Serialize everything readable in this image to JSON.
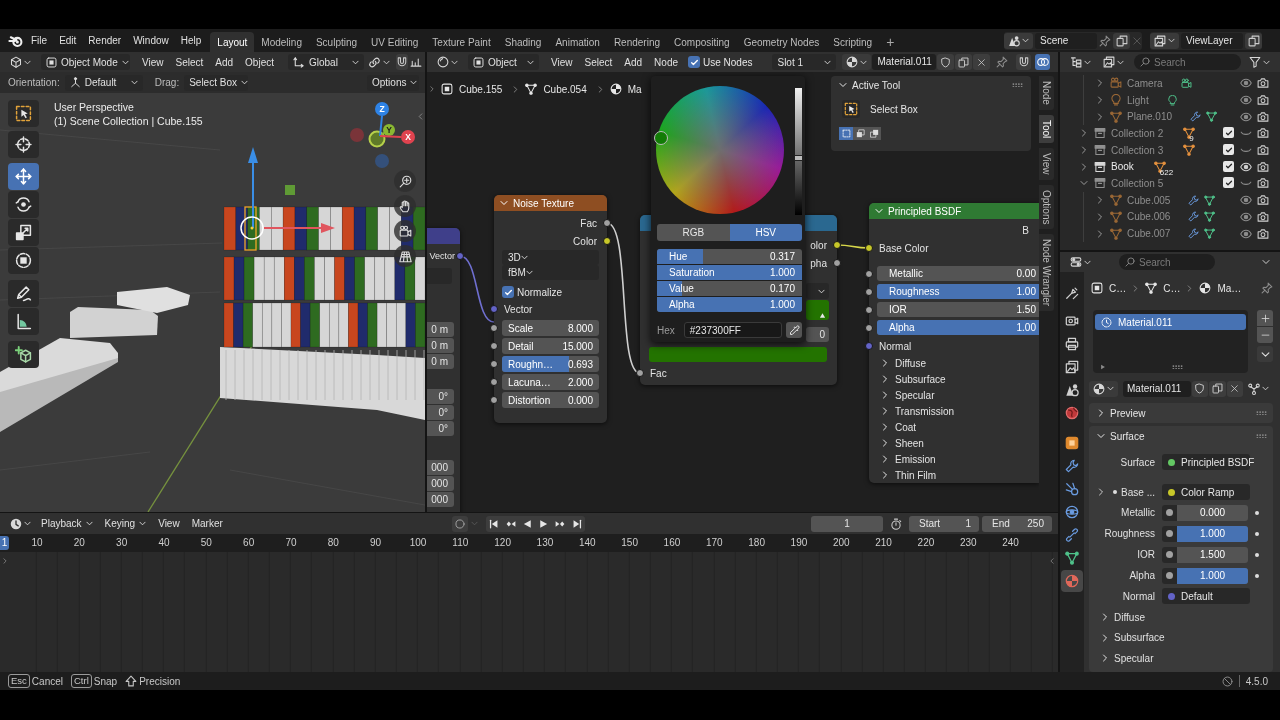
{
  "top_bar": {
    "menus": [
      "File",
      "Edit",
      "Render",
      "Window",
      "Help"
    ],
    "workspaces": [
      {
        "label": "Layout",
        "selected": true
      },
      {
        "label": "Modeling",
        "selected": false
      },
      {
        "label": "Sculpting",
        "selected": false
      },
      {
        "label": "UV Editing",
        "selected": false
      },
      {
        "label": "Texture Paint",
        "selected": false
      },
      {
        "label": "Shading",
        "selected": false
      },
      {
        "label": "Animation",
        "selected": false
      },
      {
        "label": "Rendering",
        "selected": false
      },
      {
        "label": "Compositing",
        "selected": false
      },
      {
        "label": "Geometry Nodes",
        "selected": false
      },
      {
        "label": "Scripting",
        "selected": false
      }
    ],
    "add_workspace": "+",
    "scene": "Scene",
    "view_layer": "ViewLayer"
  },
  "viewport": {
    "header": {
      "mode": "Object Mode",
      "menus": [
        "View",
        "Select",
        "Add",
        "Object"
      ],
      "orientation": "Global"
    },
    "tool_settings": {
      "orientation_label": "Orientation:",
      "orientation": "Default",
      "drag_label": "Drag:",
      "drag": "Select Box",
      "options": "Options"
    },
    "tools": [
      {
        "selected": false
      },
      {
        "selected": false
      },
      {
        "selected": true
      },
      {
        "selected": false
      },
      {
        "selected": false
      },
      {
        "selected": false
      },
      {
        "selected": false
      },
      {
        "selected": false
      },
      {
        "selected": false
      }
    ],
    "overlay_text": [
      "User Perspective",
      "(1) Scene Collection | Cube.155"
    ],
    "gizmo_axes": [
      "Z",
      "Y",
      "X"
    ]
  },
  "node_editor": {
    "header": {
      "shader_type": "Object",
      "menus": [
        "View",
        "Select",
        "Add",
        "Node"
      ],
      "use_nodes": {
        "label": "Use Nodes",
        "checked": true
      },
      "slot": "Slot 1",
      "material": "Material.011"
    },
    "breadcrumb": [
      "Cube.155",
      "Cube.054",
      "Ma"
    ],
    "mapping_node": {
      "output": "Vector",
      "values": [
        "0 m",
        "0 m",
        "0 m",
        "0°",
        "0°",
        "0°",
        "000",
        "000",
        "000"
      ]
    },
    "noise_node": {
      "title": "Noise Texture",
      "expanded": true,
      "outputs": [
        {
          "label": "Fac",
          "color": "#a1a1a1"
        },
        {
          "label": "Color",
          "color": "#c7c729"
        }
      ],
      "dropdowns": [
        "3D",
        "fBM"
      ],
      "normalize": {
        "label": "Normalize",
        "checked": true
      },
      "input": "Vector",
      "fields": [
        {
          "kind": "number",
          "label": "Scale",
          "value": "8.000"
        },
        {
          "kind": "number",
          "label": "Detail",
          "value": "15.000"
        },
        {
          "kind": "slider",
          "label": "Roughn…",
          "value": "0.693",
          "level": 0.693
        },
        {
          "kind": "number",
          "label": "Lacuna…",
          "value": "2.000"
        },
        {
          "kind": "number",
          "label": "Distortion",
          "value": "0.000"
        }
      ]
    },
    "color_ramp_node": {
      "outputs": [
        {
          "label": "olor",
          "color": "#c7c729"
        },
        {
          "label": "pha",
          "color": "#a1a1a1"
        }
      ],
      "stop_index": "0",
      "color": "#237300",
      "input": "Fac"
    },
    "color_picker": {
      "value_bar": {
        "level": 0.45
      },
      "tabs": [
        {
          "label": "RGB",
          "selected": false
        },
        {
          "label": "HSV",
          "selected": true
        }
      ],
      "sliders": [
        {
          "label": "Hue",
          "value": "0.317",
          "level": 0.317
        },
        {
          "label": "Saturation",
          "value": "1.000",
          "level": 1
        },
        {
          "label": "Value",
          "value": "0.170",
          "level": 0.17
        },
        {
          "label": "Alpha",
          "value": "1.000",
          "level": 1
        }
      ],
      "hex_label": "Hex",
      "hex": "#237300FF"
    },
    "principled_node": {
      "title": "Principled BSDF",
      "expanded": true,
      "output": "B",
      "input": "Base Color",
      "fields": [
        {
          "kind": "number",
          "label": "Metallic",
          "value": "0.00"
        },
        {
          "kind": "slider",
          "label": "Roughness",
          "value": "1.00",
          "level": 1
        },
        {
          "kind": "number",
          "label": "IOR",
          "value": "1.50"
        },
        {
          "kind": "slider",
          "label": "Alpha",
          "value": "1.00",
          "level": 1
        }
      ],
      "normal": "Normal",
      "panels": [
        {
          "label": "Diffuse",
          "expanded": false
        },
        {
          "label": "Subsurface",
          "expanded": false
        },
        {
          "label": "Specular",
          "expanded": false
        },
        {
          "label": "Transmission",
          "expanded": false
        },
        {
          "label": "Coat",
          "expanded": false
        },
        {
          "label": "Sheen",
          "expanded": false
        },
        {
          "label": "Emission",
          "expanded": false
        },
        {
          "label": "Thin Film",
          "expanded": false
        }
      ]
    },
    "sidebar": {
      "panel_title": "Active Tool",
      "panel_expanded": true,
      "tool": "Select Box",
      "modes": [
        {
          "selected": true
        },
        {
          "selected": false
        },
        {
          "selected": false
        }
      ],
      "tabs": [
        {
          "label": "Node",
          "selected": false
        },
        {
          "label": "Tool",
          "selected": true
        },
        {
          "label": "View",
          "selected": false
        },
        {
          "label": "Options",
          "selected": false
        },
        {
          "label": "Node Wrangler",
          "selected": false
        }
      ]
    }
  },
  "outliner": {
    "search": {
      "placeholder": "Search"
    },
    "continued_children": [
      {
        "kind": "camera",
        "label": "Camera",
        "expanded": false,
        "dimmed": true,
        "visible": true
      },
      {
        "kind": "light",
        "label": "Light",
        "expanded": false,
        "dimmed": true,
        "visible": true
      },
      {
        "kind": "mesh",
        "label": "Plane.010",
        "expanded": false,
        "dimmed": true,
        "visible": true
      }
    ],
    "tree": [
      {
        "kind": "collection",
        "label": "Collection 2",
        "expanded": false,
        "dimmed": true,
        "badge": {
          "kind": "mesh",
          "count": "9"
        },
        "checked": true,
        "visible": false
      },
      {
        "kind": "collection",
        "label": "Collection 3",
        "expanded": false,
        "dimmed": true,
        "badge": {
          "kind": "mesh"
        },
        "checked": true,
        "visible": false
      },
      {
        "kind": "collection",
        "label": "Book",
        "expanded": false,
        "dimmed": false,
        "badge": {
          "kind": "mesh",
          "count": "622"
        },
        "checked": true,
        "visible": true
      },
      {
        "kind": "collection",
        "label": "Collection 5",
        "expanded": true,
        "dimmed": true,
        "checked": true,
        "visible": false,
        "children": [
          {
            "kind": "mesh",
            "label": "Cube.005",
            "expanded": false,
            "dimmed": true,
            "visible": true
          },
          {
            "kind": "mesh",
            "label": "Cube.006",
            "expanded": false,
            "dimmed": true,
            "visible": true
          },
          {
            "kind": "mesh",
            "label": "Cube.007",
            "expanded": false,
            "dimmed": true,
            "visible": true
          }
        ]
      }
    ]
  },
  "properties": {
    "search": {
      "placeholder": "Search"
    },
    "tabs": [
      {
        "selected": false
      },
      {
        "selected": false
      },
      {
        "selected": false
      },
      {
        "selected": false
      },
      {
        "selected": false
      },
      {
        "selected": false
      },
      {
        "selected": false
      },
      {
        "selected": false
      },
      {
        "selected": false
      },
      {
        "selected": false
      },
      {
        "selected": false
      },
      {
        "selected": false
      },
      {
        "selected": true
      }
    ],
    "breadcrumb": [
      "C…",
      "C…",
      "Ma…"
    ],
    "slots": [
      {
        "label": "Material.011",
        "selected": true
      }
    ],
    "material": "Material.011",
    "panels": [
      {
        "label": "Preview",
        "expanded": false
      },
      {
        "label": "Surface",
        "expanded": true,
        "rows": [
          {
            "kind": "link",
            "label": "Surface",
            "value": "Principled BSDF",
            "color": "#63c763"
          },
          {
            "kind": "link",
            "label": "Base ...",
            "value": "Color Ramp",
            "color": "#c7c729",
            "expanded": false
          },
          {
            "kind": "number",
            "label": "Metallic",
            "value": "0.000",
            "color": "#a1a1a1"
          },
          {
            "kind": "slider",
            "label": "Roughness",
            "value": "1.000",
            "level": 1,
            "color": "#a1a1a1"
          },
          {
            "kind": "number",
            "label": "IOR",
            "value": "1.500",
            "color": "#a1a1a1"
          },
          {
            "kind": "slider",
            "label": "Alpha",
            "value": "1.000",
            "level": 1,
            "color": "#a1a1a1"
          },
          {
            "kind": "link",
            "label": "Normal",
            "value": "Default",
            "color": "#6363c7"
          }
        ],
        "subpanels": [
          {
            "label": "Diffuse",
            "expanded": false
          },
          {
            "label": "Subsurface",
            "expanded": false
          },
          {
            "label": "Specular",
            "expanded": false
          }
        ]
      }
    ]
  },
  "timeline": {
    "menus": [
      {
        "label": "Playback",
        "kind": "dropdown"
      },
      {
        "label": "Keying",
        "kind": "dropdown"
      },
      {
        "label": "View",
        "kind": "menu"
      },
      {
        "label": "Marker",
        "kind": "menu"
      }
    ],
    "current_frame": "1",
    "start_label": "Start",
    "start": "1",
    "end_label": "End",
    "end": "250",
    "ruler_current": "1",
    "ruler": [
      "10",
      "20",
      "30",
      "40",
      "50",
      "60",
      "70",
      "80",
      "90",
      "100",
      "110",
      "120",
      "130",
      "140",
      "150",
      "160",
      "170",
      "180",
      "190",
      "200",
      "210",
      "220",
      "230",
      "240"
    ]
  },
  "status_bar": {
    "hints": [
      {
        "kind": "key",
        "key": "Esc",
        "label": "Cancel"
      },
      {
        "kind": "key",
        "key": "Ctrl",
        "label": "Snap"
      },
      {
        "kind": "shift",
        "label": "Precision"
      }
    ],
    "version": "4.5.0"
  }
}
